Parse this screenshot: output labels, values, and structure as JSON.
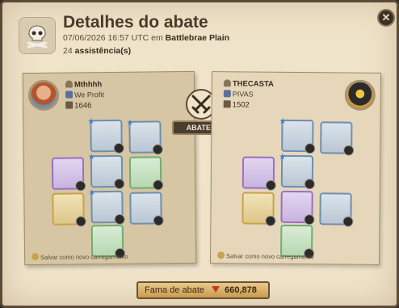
{
  "window": {
    "title": "Detalhes do abate",
    "datetime": "07/06/2026 16:57 UTC em",
    "location": "Battlebrae Plain",
    "assists_count": "24",
    "assists_label": "assistência(s)",
    "close_label": "✕"
  },
  "killer": {
    "name": "Mthhhh",
    "guild": "We Profit",
    "ip": "1646",
    "save_label": "Salvar como novo carregamento"
  },
  "victim": {
    "name": "THECASTA",
    "guild": "PIVAS",
    "ip": "1502",
    "save_label": "Salvar como novo carregamento"
  },
  "badge": {
    "killed_label": "ABATEU"
  },
  "fame": {
    "label": "Fama de abate",
    "value": "660,878"
  },
  "colors": {
    "accent": "#c0392b",
    "frame": "#5a4a36",
    "paper": "#efe3c9"
  }
}
